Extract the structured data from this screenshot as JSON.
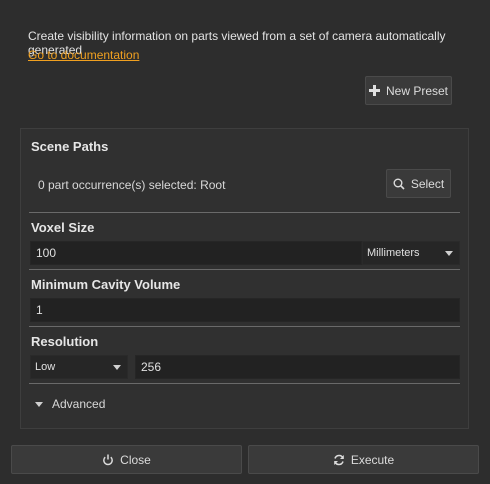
{
  "header": {
    "description": "Create visibility information on parts viewed from a set of camera automatically generated",
    "doc_link": "Go to documentation"
  },
  "preset": {
    "label": "New Preset",
    "icon": "plus-icon"
  },
  "scene_paths": {
    "title": "Scene Paths",
    "selection_text": "0 part occurrence(s) selected: Root",
    "select_label": "Select",
    "select_icon": "search-icon"
  },
  "voxel_size": {
    "title": "Voxel Size",
    "value": "100",
    "unit": "Millimeters"
  },
  "min_cavity": {
    "title": "Minimum Cavity Volume",
    "value": "1"
  },
  "resolution": {
    "title": "Resolution",
    "preset": "Low",
    "value": "256"
  },
  "advanced": {
    "label": "Advanced"
  },
  "footer": {
    "close_label": "Close",
    "close_icon": "power-icon",
    "execute_label": "Execute",
    "execute_icon": "refresh-icon"
  },
  "colors": {
    "background": "#2d2d2d",
    "link": "#f0a020",
    "field": "#222222"
  }
}
